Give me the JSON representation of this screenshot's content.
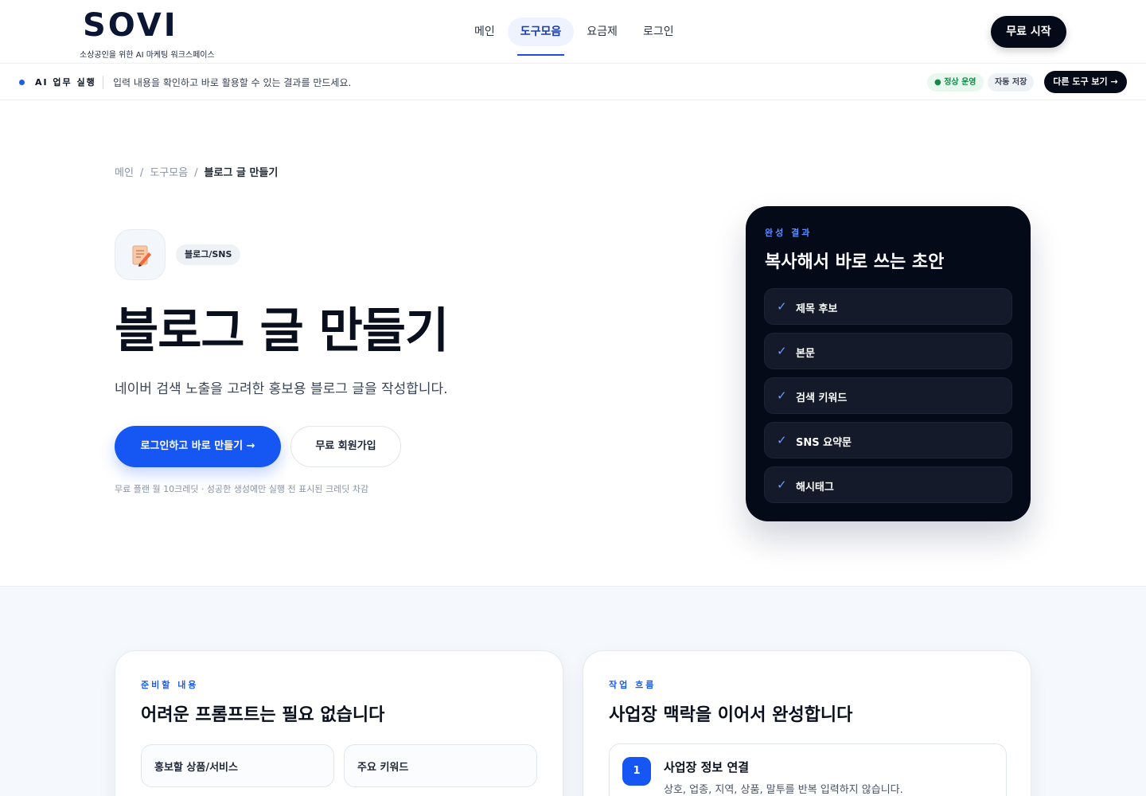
{
  "header": {
    "logo_text": "SOVI",
    "logo_tagline": "소상공인을 위한 AI 마케팅 워크스페이스",
    "nav": [
      {
        "label": "메인"
      },
      {
        "label": "도구모음"
      },
      {
        "label": "요금제"
      },
      {
        "label": "로그인"
      }
    ],
    "active_nav": "도구모음",
    "cta_label": "무료 시작"
  },
  "subbar": {
    "label": "AI 업무 실행",
    "text": "입력 내용을 확인하고 바로 활용할 수 있는 결과를 만드세요.",
    "status_label": "● 정상 운영",
    "save_label": "자동 저장",
    "other_tools_label": "다른 도구 보기 →"
  },
  "breadcrumb": {
    "items": [
      "메인",
      "도구모음",
      "블로그 글 만들기"
    ],
    "separator": "/"
  },
  "hero": {
    "icon": "memo-pencil-icon",
    "category_tag": "블로그/SNS",
    "title": "블로그 글 만들기",
    "description": "네이버 검색 노출을 고려한 홍보용 블로그 글을 작성합니다.",
    "primary_button": "로그인하고 바로 만들기 →",
    "secondary_button": "무료 회원가입",
    "note": "무료 플랜 월 10크레딧 · 성공한 생성에만 실행 전 표시된 크레딧 차감"
  },
  "result_card": {
    "eyebrow": "완성 결과",
    "title": "복사해서 바로 쓰는 초안",
    "check_glyph": "✓",
    "items": [
      "제목 후보",
      "본문",
      "검색 키워드",
      "SNS 요약문",
      "해시태그"
    ]
  },
  "prep_panel": {
    "eyebrow": "준비할 내용",
    "title": "어려운 프롬프트는 필요 없습니다",
    "fields": [
      "홍보할 상품/서비스",
      "주요 키워드"
    ]
  },
  "flow_panel": {
    "eyebrow": "작업 흐름",
    "title": "사업장 맥락을 이어서 완성합니다",
    "steps": [
      {
        "number": "1",
        "title": "사업장 정보 연결",
        "description": "상호, 업종, 지역, 상품, 말투를 반복 입력하지 않습니다."
      }
    ]
  },
  "colors": {
    "primary": "#1656f2",
    "dark": "#050a18",
    "status_green": "#118a45"
  }
}
